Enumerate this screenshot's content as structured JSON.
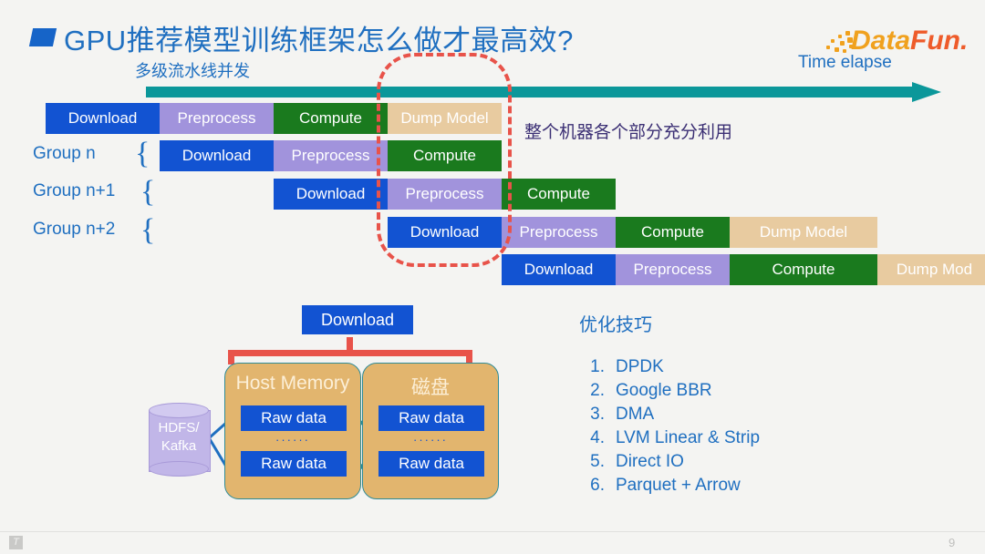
{
  "slide": {
    "title": "GPU推荐模型训练框架怎么做才最高效?",
    "subtitle": "多级流水线并发",
    "note": "整个机器各个部分充分利用",
    "time_axis_label": "Time elapse",
    "page_number": "9",
    "footer_icon": "T"
  },
  "logo": {
    "part1": "Data",
    "part2": "Fun."
  },
  "pipeline": {
    "group_labels": [
      "Group n",
      "Group n+1",
      "Group n+2"
    ],
    "brace": "{",
    "rows": [
      {
        "segments": [
          {
            "label": "Download",
            "type": "download"
          },
          {
            "label": "Preprocess",
            "type": "preprocess"
          },
          {
            "label": "Compute",
            "type": "compute"
          },
          {
            "label": "Dump Model",
            "type": "dump"
          }
        ]
      },
      {
        "segments": [
          {
            "label": "Download",
            "type": "download"
          },
          {
            "label": "Preprocess",
            "type": "preprocess"
          },
          {
            "label": "Compute",
            "type": "compute"
          }
        ]
      },
      {
        "segments": [
          {
            "label": "Download",
            "type": "download"
          },
          {
            "label": "Preprocess",
            "type": "preprocess"
          },
          {
            "label": "Compute",
            "type": "compute"
          }
        ]
      },
      {
        "segments": [
          {
            "label": "Download",
            "type": "download"
          },
          {
            "label": "Preprocess",
            "type": "preprocess"
          },
          {
            "label": "Compute",
            "type": "compute"
          },
          {
            "label": "Dump Model",
            "type": "dump"
          }
        ]
      },
      {
        "segments": [
          {
            "label": "Download",
            "type": "download"
          },
          {
            "label": "Preprocess",
            "type": "preprocess"
          },
          {
            "label": "Compute",
            "type": "compute"
          },
          {
            "label": "Dump Mod",
            "type": "dump"
          }
        ]
      }
    ]
  },
  "storage": {
    "download_label": "Download",
    "source_label_line1": "HDFS/",
    "source_label_line2": "Kafka",
    "boxes": [
      {
        "title": "Host Memory",
        "items": [
          "Raw data",
          "Raw data"
        ],
        "ellipsis": "······"
      },
      {
        "title": "磁盘",
        "items": [
          "Raw data",
          "Raw data"
        ],
        "ellipsis": "······"
      }
    ]
  },
  "tips": {
    "title": "优化技巧",
    "items": [
      {
        "num": "1.",
        "label": "DPDK"
      },
      {
        "num": "2.",
        "label": "Google BBR"
      },
      {
        "num": "3.",
        "label": "DMA"
      },
      {
        "num": "4.",
        "label": "LVM Linear & Strip"
      },
      {
        "num": "5.",
        "label": "Direct IO"
      },
      {
        "num": "6.",
        "label": "Parquet + Arrow"
      }
    ]
  },
  "colors": {
    "download": "#1253D2",
    "preprocess": "#A193DC",
    "compute": "#1A7A1E",
    "dump": "#E8CBA0",
    "accent_blue": "#1F6FC0",
    "teal": "#0B979A",
    "red": "#E8534A",
    "tan": "#E2B56E",
    "lavender": "#C1B6E8"
  }
}
